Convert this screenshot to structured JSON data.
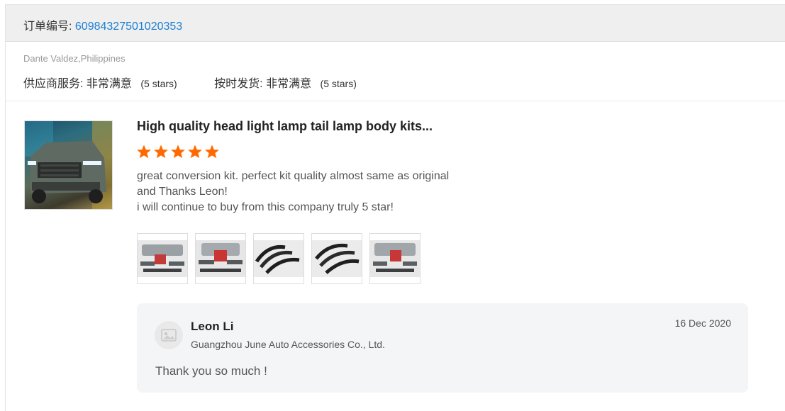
{
  "order": {
    "label": "订单编号:",
    "number": "60984327501020353"
  },
  "buyer": {
    "name_country": "Dante Valdez,Philippines"
  },
  "ratings": [
    {
      "label": "供应商服务:",
      "value": "非常满意",
      "stars_text": "(5 stars)"
    },
    {
      "label": "按时发货:",
      "value": "非常满意",
      "stars_text": "(5 stars)"
    }
  ],
  "product": {
    "title": "High quality head light lamp tail lamp body kits...",
    "thumbnail_icon": "truck-photo",
    "rating": 5,
    "rating_max": 5
  },
  "review": {
    "lines": [
      "great conversion kit. perfect kit quality almost same as original",
      "and Thanks Leon!",
      "i will continue to buy from this company truly 5 star!"
    ]
  },
  "review_photos": [
    {
      "icon": "body-kit-photo"
    },
    {
      "icon": "body-kit-photo"
    },
    {
      "icon": "fender-flares-photo"
    },
    {
      "icon": "fender-flares-photo"
    },
    {
      "icon": "body-kit-photo"
    }
  ],
  "reply": {
    "seller_name": "Leon Li",
    "company": "Guangzhou June Auto Accessories Co., Ltd.",
    "date": "16 Dec 2020",
    "text": "Thank you so much !",
    "avatar_icon": "avatar-placeholder-icon"
  },
  "colors": {
    "accent_link": "#1a7fd1",
    "star": "#ff6a00",
    "header_bg": "#efefef",
    "reply_bg": "#f4f5f7"
  }
}
